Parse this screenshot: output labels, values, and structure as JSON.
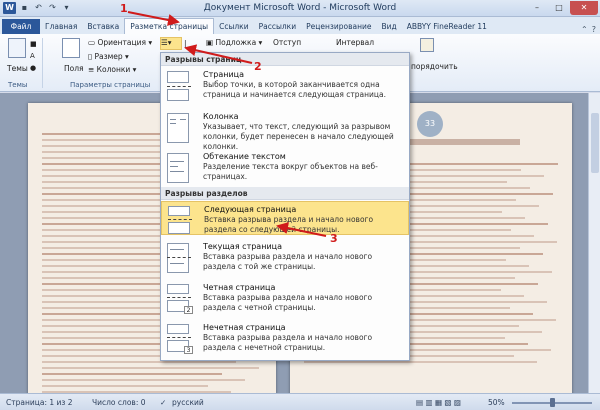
{
  "window": {
    "title": "Документ Microsoft Word - Microsoft Word",
    "app_icon": "W",
    "minimize": "–",
    "maximize": "□",
    "close": "✕"
  },
  "ribbon_tabs": [
    {
      "label": "Файл"
    },
    {
      "label": "Главная"
    },
    {
      "label": "Вставка"
    },
    {
      "label": "Разметка страницы"
    },
    {
      "label": "Ссылки"
    },
    {
      "label": "Рассылки"
    },
    {
      "label": "Рецензирование"
    },
    {
      "label": "Вид"
    },
    {
      "label": "ABBYY FineReader 11"
    }
  ],
  "ribbon": {
    "themes_label": "Темы",
    "themes_group": "Темы",
    "margins_label": "Поля",
    "orientation_label": "Ориентация",
    "size_label": "Размер",
    "columns_label": "Колонки",
    "page_setup_group": "Параметры страницы",
    "background_label": "Подложка",
    "indent_label": "Отступ",
    "spacing_label": "Интервал",
    "arrange_label": "порядочить"
  },
  "breaks_menu": {
    "page_breaks_header": "Разрывы страниц",
    "section_breaks_header": "Разрывы разделов",
    "items": [
      {
        "title": "Страница",
        "desc": "Выбор точки, в которой заканчивается одна страница и начинается следующая страница."
      },
      {
        "title": "Колонка",
        "desc": "Указывает, что текст, следующий за разрывом колонки, будет перенесен в начало следующей колонки."
      },
      {
        "title": "Обтекание текстом",
        "desc": "Разделение текста вокруг объектов на веб-страницах."
      },
      {
        "title": "Следующая страница",
        "desc": "Вставка разрыва раздела и начало нового раздела со следующей страницы."
      },
      {
        "title": "Текущая страница",
        "desc": "Вставка разрыва раздела и начало нового раздела с той же страницы."
      },
      {
        "title": "Четная страница",
        "desc": "Вставка разрыва раздела и начало нового раздела с четной страницы."
      },
      {
        "title": "Нечетная страница",
        "desc": "Вставка разрыва раздела и начало нового раздела с нечетной страницы."
      }
    ]
  },
  "annotations": {
    "one": "1",
    "two": "2",
    "three": "3"
  },
  "document": {
    "page_number": "33"
  },
  "status_bar": {
    "page": "Страница: 1 из 2",
    "words": "Число слов: 0",
    "language": "русский",
    "zoom": "50%",
    "zoom_level": 0.5
  }
}
